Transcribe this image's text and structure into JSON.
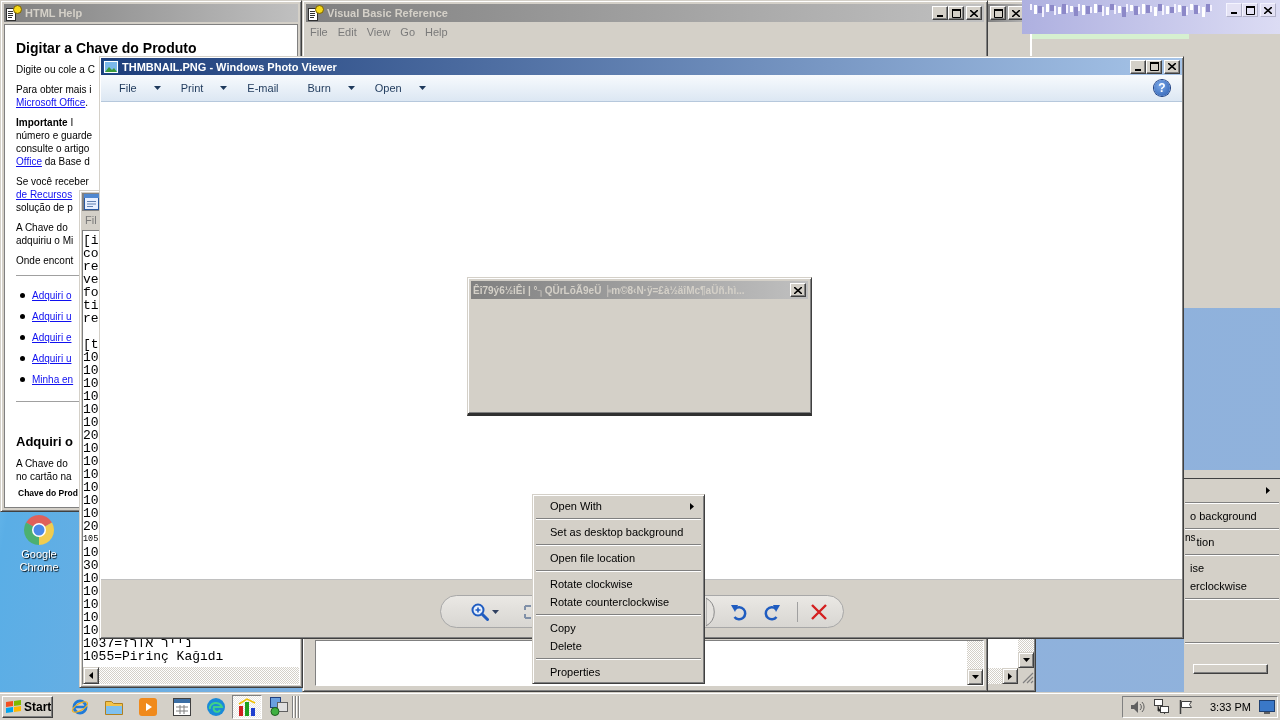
{
  "desktop": {
    "shortcut": {
      "label": "Google Chrome"
    }
  },
  "help_window": {
    "title": "HTML Help",
    "active": false,
    "content": [
      {
        "kind": "heading",
        "text": "Digitar a Chave do Produto"
      },
      {
        "kind": "paragraph",
        "lines": [
          [
            {
              "text": "Digite ou cole a C",
              "link": false
            }
          ]
        ]
      },
      {
        "kind": "paragraph",
        "lines": [
          [
            {
              "text": "Para obter mais i",
              "link": false
            }
          ],
          [
            {
              "text": "Microsoft Office",
              "link": true
            },
            {
              "text": ".",
              "link": false
            }
          ]
        ]
      },
      {
        "kind": "paragraph",
        "lines": [
          [
            {
              "text": "**Importante**  I",
              "link": false
            }
          ],
          [
            {
              "text": "número e guarde",
              "link": false
            }
          ],
          [
            {
              "text": "consulte o artigo",
              "link": false
            }
          ],
          [
            {
              "text": "Office",
              "link": true
            },
            {
              "text": " da Base d",
              "link": false
            }
          ]
        ]
      },
      {
        "kind": "paragraph",
        "lines": [
          [
            {
              "text": "Se você receber",
              "link": false
            }
          ],
          [
            {
              "text": "de Recursos",
              "link": true
            }
          ],
          [
            {
              "text": "solução de p",
              "link": false
            }
          ]
        ]
      },
      {
        "kind": "paragraph",
        "lines": [
          [
            {
              "text": "A Chave do",
              "link": false
            }
          ],
          [
            {
              "text": "adquiriu o Mi",
              "link": false
            }
          ]
        ]
      },
      {
        "kind": "paragraph",
        "lines": [
          [
            {
              "text": "Onde encont",
              "link": false
            }
          ]
        ]
      },
      {
        "kind": "rule"
      },
      {
        "kind": "bullets",
        "items": [
          {
            "text": "Adquiri o",
            "link": true
          },
          {
            "text": "Adquiri u",
            "link": true
          },
          {
            "text": "Adquiri e",
            "link": true
          },
          {
            "text": "Adquiri u",
            "link": true
          },
          {
            "text": "Minha en",
            "link": true
          }
        ]
      },
      {
        "kind": "rule"
      },
      {
        "kind": "subheading",
        "text": "Adquiri o"
      },
      {
        "kind": "paragraph",
        "lines": [
          [
            {
              "text": "A Chave do",
              "link": false
            }
          ],
          [
            {
              "text": "no cartão na",
              "link": false
            }
          ]
        ]
      },
      {
        "kind": "caption",
        "text": "Chave do Prod"
      }
    ]
  },
  "reference_window": {
    "title": "Visual Basic Reference",
    "active": false,
    "menu": [
      {
        "label": "File",
        "disabled": true
      },
      {
        "label": "Edit",
        "disabled": true
      },
      {
        "label": "View",
        "disabled": true
      },
      {
        "label": "Go",
        "disabled": true
      },
      {
        "label": "Help",
        "disabled": true
      }
    ]
  },
  "background_window": {
    "active": false
  },
  "ghost_menu": {
    "rows": [
      {
        "kind": "submenu"
      },
      {
        "kind": "separator"
      },
      {
        "kind": "text",
        "text": "o background"
      },
      {
        "kind": "separator"
      },
      {
        "kind": "text",
        "text": "tion",
        "fragment": "ns"
      },
      {
        "kind": "separator"
      },
      {
        "kind": "text",
        "text": "ise"
      },
      {
        "kind": "text",
        "text": "erclockwise"
      },
      {
        "kind": "separator"
      },
      {
        "kind": "blank"
      },
      {
        "kind": "blank"
      },
      {
        "kind": "separator"
      }
    ]
  },
  "notepad_window": {
    "active": false,
    "menu": [
      {
        "label": "Fil",
        "disabled": true
      }
    ],
    "sections": [
      [
        {
          "text": "[i",
          "small": false
        },
        {
          "text": "co",
          "small": false
        },
        {
          "text": "re",
          "small": false
        },
        {
          "text": "ve",
          "small": false
        },
        {
          "text": "fo",
          "small": false
        },
        {
          "text": "ti",
          "small": false
        },
        {
          "text": "re",
          "small": false
        }
      ],
      [
        {
          "text": "[t",
          "small": false
        },
        {
          "text": "10",
          "small": false
        },
        {
          "text": "10",
          "small": false
        },
        {
          "text": "10",
          "small": false
        },
        {
          "text": "10",
          "small": false
        },
        {
          "text": "10",
          "small": false
        },
        {
          "text": "10",
          "small": false
        },
        {
          "text": "20",
          "small": false
        },
        {
          "text": "10",
          "small": false
        },
        {
          "text": "10",
          "small": false
        },
        {
          "text": "10",
          "small": false
        },
        {
          "text": "10",
          "small": false
        },
        {
          "text": "10",
          "small": false
        },
        {
          "text": "10",
          "small": false
        },
        {
          "text": "20",
          "small": false
        },
        {
          "text": "105",
          "small": true
        },
        {
          "text": "10",
          "small": false
        },
        {
          "text": "30",
          "small": false
        },
        {
          "text": "10",
          "small": false
        },
        {
          "text": "10",
          "small": false
        },
        {
          "text": "10",
          "small": false
        },
        {
          "text": "10",
          "small": false
        },
        {
          "text": "10",
          "small": false
        },
        {
          "text": "1037=נייר אורז",
          "small": false
        },
        {
          "text": "1055=Pirinç Kağıdı",
          "small": false
        }
      ]
    ]
  },
  "photo_viewer": {
    "title": "THMBNAIL.PNG - Windows Photo Viewer",
    "active": true,
    "toolbar": [
      {
        "label": "File",
        "dropdown": true
      },
      {
        "label": "Print",
        "dropdown": true
      },
      {
        "label": "E-mail",
        "dropdown": false
      },
      {
        "label": "Burn",
        "dropdown": true
      },
      {
        "label": "Open",
        "dropdown": true
      }
    ],
    "help": "?"
  },
  "dialog": {
    "title": "Êî79ý6½iÊi | °┐QÜrLõÃ9eÜ ╞m©8‹N·ÿ=£à½äîMc¶aÜñ.hì...",
    "active": false
  },
  "context_menu": {
    "groups": [
      [
        {
          "label": "Open With",
          "submenu": true
        }
      ],
      [
        {
          "label": "Set as desktop background",
          "submenu": false
        }
      ],
      [
        {
          "label": "Open file location",
          "submenu": false
        }
      ],
      [
        {
          "label": "Rotate clockwise",
          "submenu": false
        },
        {
          "label": "Rotate counterclockwise",
          "submenu": false
        }
      ],
      [
        {
          "label": "Copy",
          "submenu": false
        },
        {
          "label": "Delete",
          "submenu": false
        }
      ],
      [
        {
          "label": "Properties",
          "submenu": false
        }
      ]
    ]
  },
  "taskbar": {
    "start": "Start",
    "tasks": [
      {
        "selected": true
      },
      {
        "selected": false
      }
    ],
    "clock": "3:33 PM"
  }
}
